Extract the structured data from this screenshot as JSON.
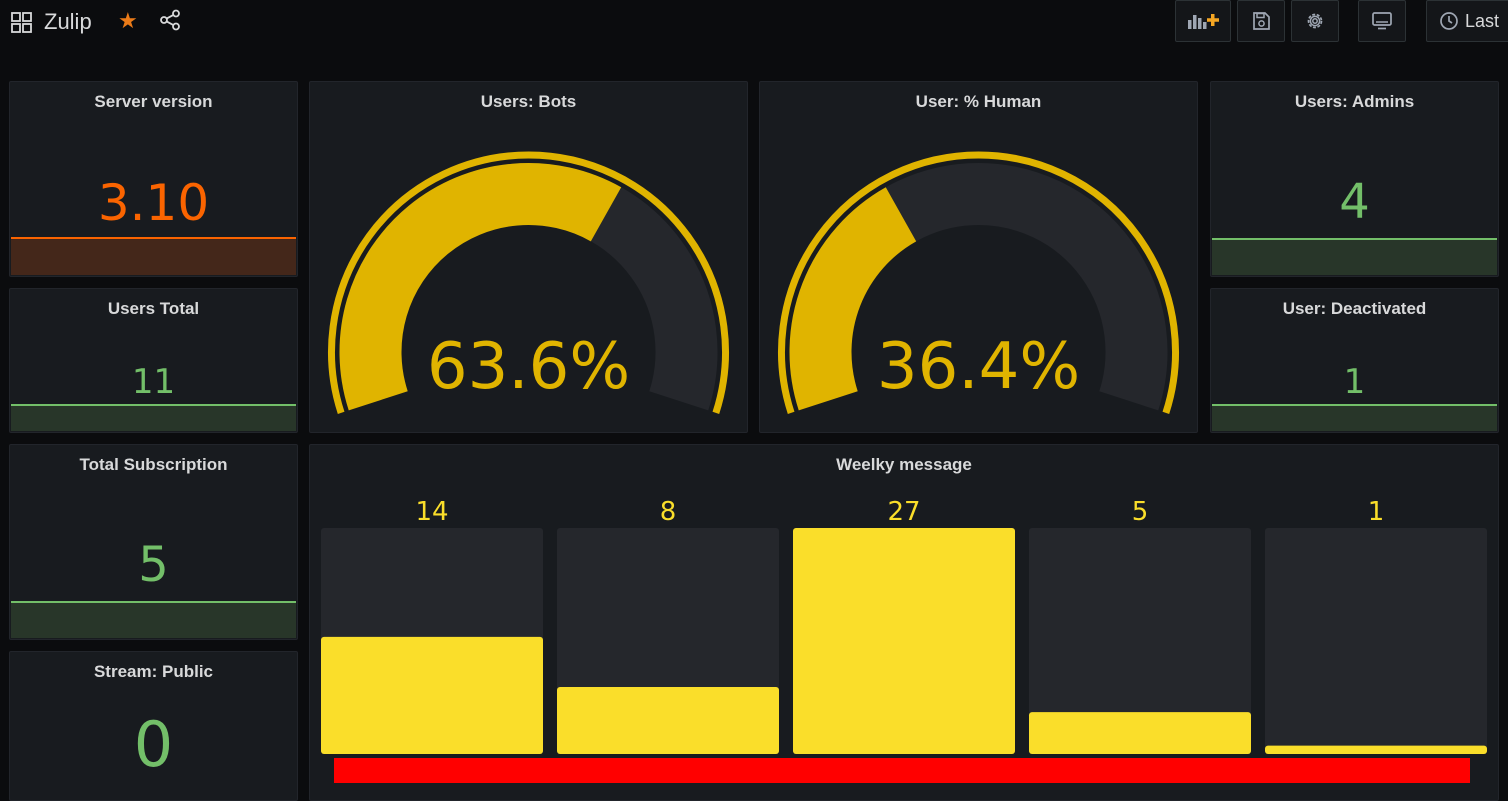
{
  "header": {
    "title": "Zulip",
    "time_label": "Last"
  },
  "panels": {
    "server_version": {
      "title": "Server version",
      "value": "3.10",
      "color": "#fa6400"
    },
    "users_total": {
      "title": "Users Total",
      "value": "11",
      "color": "#73bf69"
    },
    "total_subscription": {
      "title": "Total Subscription",
      "value": "5",
      "color": "#73bf69"
    },
    "stream_public": {
      "title": "Stream: Public",
      "value": "0",
      "color": "#73bf69"
    },
    "users_admins": {
      "title": "Users: Admins",
      "value": "4",
      "color": "#73bf69"
    },
    "user_deactivated": {
      "title": "User: Deactivated",
      "value": "1",
      "color": "#73bf69"
    },
    "users_bots": {
      "title": "Users: Bots",
      "value": "63.6%",
      "percent": 63.6,
      "color": "#e0b400"
    },
    "user_human": {
      "title": "User: % Human",
      "value": "36.4%",
      "percent": 36.4,
      "color": "#e0b400"
    }
  },
  "chart_data": {
    "type": "bar",
    "title": "Weelky message",
    "values": [
      14,
      8,
      27,
      5,
      1
    ],
    "labels": [
      "14",
      "8",
      "27",
      "5",
      "1"
    ],
    "ylim": [
      0,
      27
    ],
    "bar_color": "#fade2a",
    "track_color": "#25272c",
    "threshold_color": "#ff0000"
  }
}
